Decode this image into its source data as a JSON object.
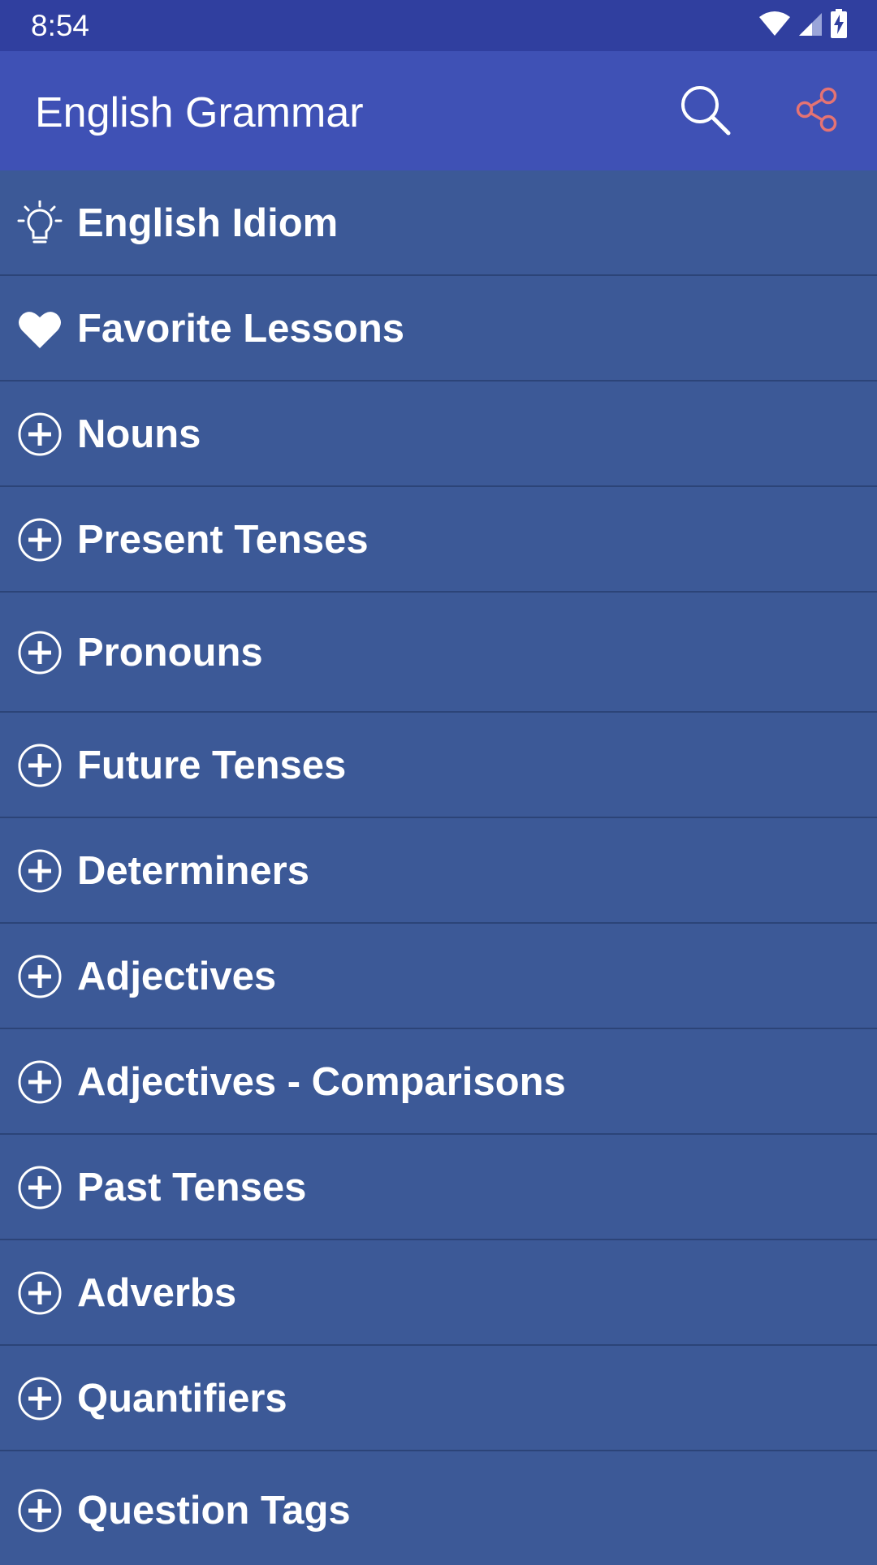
{
  "status_bar": {
    "time": "8:54",
    "icons": [
      "wifi-icon",
      "cellular-signal-icon",
      "battery-charging-icon"
    ]
  },
  "app_bar": {
    "title": "English Grammar",
    "actions": [
      {
        "icon": "search-icon"
      },
      {
        "icon": "share-icon",
        "color": "#e57373"
      }
    ]
  },
  "colors": {
    "status_bar": "#303f9f",
    "app_bar": "#3f51b5",
    "list_background": "#3c5997",
    "divider": "#2c4478",
    "text": "#ffffff",
    "share_accent": "#e57373"
  },
  "menu": {
    "items": [
      {
        "label": "English Idiom",
        "icon": "lightbulb-icon"
      },
      {
        "label": "Favorite Lessons",
        "icon": "heart-icon"
      },
      {
        "label": "Nouns",
        "icon": "plus-circle-icon"
      },
      {
        "label": "Present Tenses",
        "icon": "plus-circle-icon"
      },
      {
        "label": "Pronouns",
        "icon": "plus-circle-icon"
      },
      {
        "label": "Future Tenses",
        "icon": "plus-circle-icon"
      },
      {
        "label": "Determiners",
        "icon": "plus-circle-icon"
      },
      {
        "label": "Adjectives",
        "icon": "plus-circle-icon"
      },
      {
        "label": "Adjectives - Comparisons",
        "icon": "plus-circle-icon"
      },
      {
        "label": "Past Tenses",
        "icon": "plus-circle-icon"
      },
      {
        "label": "Adverbs",
        "icon": "plus-circle-icon"
      },
      {
        "label": "Quantifiers",
        "icon": "plus-circle-icon"
      },
      {
        "label": "Question Tags",
        "icon": "plus-circle-icon"
      }
    ]
  }
}
